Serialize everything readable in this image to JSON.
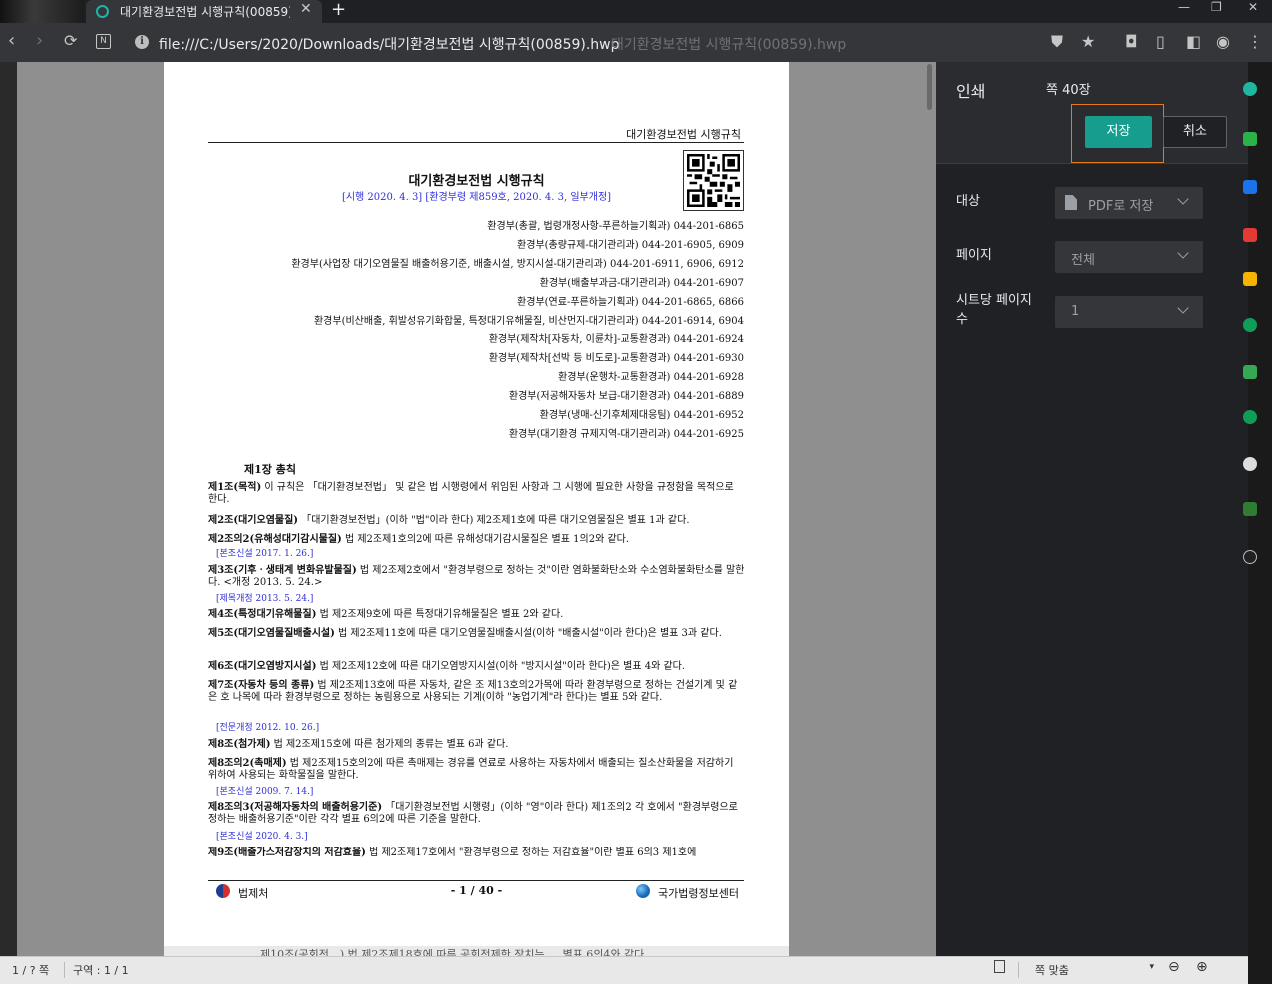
{
  "browser": {
    "tab_title": "대기환경보전법 시행규칙(00859)",
    "tab_close": "✕",
    "new_tab": "+",
    "min": "—",
    "max": "❐",
    "close": "✕",
    "url": "file:///C:/Users/2020/Downloads/대기환경보전법 시행규칙(00859).hwp",
    "url_ghost": "대기환경보전법 시행규칙(00859).hwp"
  },
  "document": {
    "running_header": "대기환경보전법 시행규칙",
    "title": "대기환경보전법 시행규칙",
    "subtitle": "[시행 2020. 4. 3] [환경부령 제859호, 2020. 4. 3, 일부개정]",
    "contacts": [
      "환경부(총괄, 법령개정사항-푸른하늘기획과) 044-201-6865",
      "환경부(총량규제-대기관리과) 044-201-6905, 6909",
      "환경부(사업장 대기오염물질 배출허용기준, 배출시설, 방지시설-대기관리과) 044-201-6911, 6906, 6912",
      "환경부(배출부과금-대기관리과) 044-201-6907",
      "환경부(연료-푸른하늘기획과) 044-201-6865, 6866",
      "환경부(비산배출, 휘발성유기화합물, 특정대기유해물질, 비산먼지-대기관리과) 044-201-6914, 6904",
      "환경부(제작차[자동차, 이륜차]-교통환경과) 044-201-6924",
      "환경부(제작차[선박 등 비도로]-교통환경과) 044-201-6930",
      "환경부(운행차-교통환경과) 044-201-6928",
      "환경부(저공해자동차 보급-대기환경과) 044-201-6889",
      "환경부(냉매-신기후체제대응팀) 044-201-6952",
      "환경부(대기환경 규제지역-대기관리과) 044-201-6925"
    ],
    "chapter": "제1장 총칙",
    "articles": [
      {
        "head": "제1조(목적)",
        "body": " 이 규칙은 「대기환경보전법」 및 같은 법 시행령에서 위임된 사항과 그 시행에 필요한 사항을 규정함을 목적으로 한다."
      },
      {
        "head": "제2조(대기오염물질)",
        "body": " 「대기환경보전법」(이하 \"법\"이라 한다) 제2조제1호에 따른 대기오염물질은 별표 1과 같다."
      },
      {
        "head": "제2조의2(유해성대기감시물질)",
        "body": " 법 제2조제1호의2에 따른 유해성대기감시물질은 별표 1의2와 같다."
      },
      {
        "head": "제3조(기후ㆍ생태계 변화유발물질)",
        "body": " 법 제2조제2호에서 \"환경부령으로 정하는 것\"이란 염화불화탄소와 수소염화불화탄소를 말한다. <개정 2013. 5. 24.>"
      },
      {
        "head": "제4조(특정대기유해물질)",
        "body": " 법 제2조제9호에 따른 특정대기유해물질은 별표 2와 같다."
      },
      {
        "head": "제5조(대기오염물질배출시설)",
        "body": " 법 제2조제11호에 따른 대기오염물질배출시설(이하 \"배출시설\"이라 한다)은 별표 3과 같다."
      },
      {
        "head": "제6조(대기오염방지시설)",
        "body": " 법 제2조제12호에 따른 대기오염방지시설(이하 \"방지시설\"이라 한다)은 별표 4와 같다."
      },
      {
        "head": "제7조(자동차 등의 종류)",
        "body": " 법 제2조제13호에 따른 자동차, 같은 조 제13호의2가목에 따라 환경부령으로 정하는 건설기계 및 같은 호 나목에 따라 환경부령으로 정하는 농림용으로 사용되는 기계(이하 \"농업기계\"라 한다)는 별표 5와 같다."
      },
      {
        "head": "제8조(첨가제)",
        "body": " 법 제2조제15호에 따른 첨가제의 종류는 별표 6과 같다."
      },
      {
        "head": "제8조의2(촉매제)",
        "body": " 법 제2조제15호의2에 따른 촉매제는 경유를 연료로 사용하는 자동차에서 배출되는 질소산화물을 저감하기 위하여 사용되는 화학물질을 말한다."
      },
      {
        "head": "제8조의3(저공해자동차의 배출허용기준)",
        "body": " 「대기환경보전법 시행령」(이하 \"영\"이라 한다) 제1조의2 각 호에서 \"환경부령으로 정하는 배출허용기준\"이란 각각 별표 6의2에 따른 기준을 말한다."
      },
      {
        "head": "제9조(배출가스저감장치의 저감효율)",
        "body": " 법 제2조제17호에서 \"환경부령으로 정하는 저감효율\"이란 별표 6의3 제1호에"
      }
    ],
    "notes": {
      "n1": "[본조신설 2017. 1. 26.]",
      "n2": "[제목개정 2013. 5. 24.]",
      "n3": "[전문개정 2012. 10. 26.]",
      "n4": "[본조신설 2009. 7. 14.]",
      "n5": "[본조신설 2020. 4. 3.]"
    },
    "footer_left": "법제처",
    "footer_center": "- 1 / 40 -",
    "footer_right": "국가법령정보센터",
    "under_page_text": "제10조(공회전…) 법 제2조제18호에 따른 공회전제한 장치는 … 별표 6의4와 같다."
  },
  "status": {
    "page": "1 / ? 쪽",
    "section": "구역 : 1 / 1",
    "zoom_label": "쪽 맞춤"
  },
  "print": {
    "title": "인쇄",
    "page_count": "쪽 40장",
    "save_label": "저장",
    "cancel_label": "취소",
    "destination_label": "대상",
    "destination_value": "PDF로 저장",
    "pages_label": "페이지",
    "pages_value": "전체",
    "per_sheet_label": "시트당 페이지 수",
    "per_sheet_value": "1"
  },
  "colors": {
    "accent": "#169d8e",
    "focus": "#e8781a",
    "link_blue": "#2f2fd8"
  }
}
